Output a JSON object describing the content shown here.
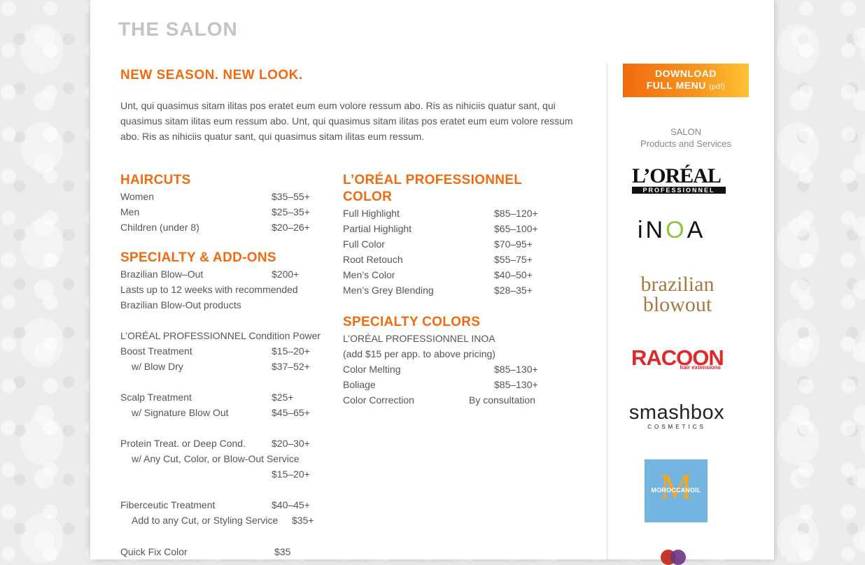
{
  "page_title": "THE SALON",
  "headline": "NEW SEASON. NEW LOOK.",
  "intro": "Unt, qui quasimus sitam ilitas pos eratet eum eum volore ressum abo. Ris as nihiciis quatur sant, qui quasimus sitam ilitas eum ressum abo. Unt, qui quasimus sitam ilitas pos eratet eum eum volore ressum abo. Ris as nihiciis quatur sant, qui quasimus sitam ilitas eum ressum.",
  "haircuts": {
    "title": "HAIRCUTS",
    "rows": [
      {
        "label": "Women",
        "price": "$35–55+"
      },
      {
        "label": "Men",
        "price": "$25–35+"
      },
      {
        "label": "Children (under 8)",
        "price": "$20–26+"
      }
    ]
  },
  "specialty": {
    "title": "SPECIALTY & ADD-ONS",
    "blowout": {
      "label": "Brazilian Blow–Out",
      "price": "$200+"
    },
    "blowout_note_1": "Lasts up to 12 weeks with recommended",
    "blowout_note_2": "Brazilian Blow-Out products",
    "condition_power": "L’ORÉAL PROFESSIONNEL Condition Power",
    "boost": {
      "label": "Boost Treatment",
      "price": "$15–20+"
    },
    "boost_dry": {
      "label": "w/ Blow Dry",
      "price": "$37–52+"
    },
    "scalp": {
      "label": "Scalp Treatment",
      "price": "$25+"
    },
    "scalp_blow": {
      "label": "w/ Signature Blow Out",
      "price": "$45–65+"
    },
    "protein": {
      "label": "Protein Treat. or Deep Cond.",
      "price": "$20–30+"
    },
    "protein_with": "w/ Any Cut, Color, or Blow-Out Service",
    "protein_with_price": "$15–20+",
    "fiberceutic": {
      "label": "Fiberceutic Treatment",
      "price": "$40–45+"
    },
    "fiberceutic_add": {
      "label": "Add to any Cut, or Styling Service",
      "price": "$35+"
    },
    "quick_fix": {
      "label": "Quick Fix Color",
      "price": "$35"
    }
  },
  "color": {
    "title_line1": "L’ORÉAL PROFESSIONNEL",
    "title_line2": "COLOR",
    "rows": [
      {
        "label": "Full Highlight",
        "price": "$85–120+"
      },
      {
        "label": "Partial Highlight",
        "price": "$65–100+"
      },
      {
        "label": "Full Color",
        "price": "$70–95+"
      },
      {
        "label": "Root Retouch",
        "price": "$55–75+"
      },
      {
        "label": "Men’s Color",
        "price": "$40–50+"
      },
      {
        "label": "Men’s Grey Blending",
        "price": "$28–35+"
      }
    ]
  },
  "specialty_colors": {
    "title": "SPECIALTY COLORS",
    "line1": "L’ORÉAL PROFESSIONNEL INOA",
    "line2": "(add $15 per app. to above pricing)",
    "rows": [
      {
        "label": "Color Melting",
        "price": "$85–130+"
      },
      {
        "label": "Boliage",
        "price": "$85–130+"
      },
      {
        "label": "Color Correction",
        "price": "By consultation"
      }
    ]
  },
  "sidebar": {
    "download_line1": "DOWNLOAD",
    "download_line2": "FULL MENU",
    "download_pdf": "(pdf)",
    "heading_line1": "SALON",
    "heading_line2": "Products and Services",
    "loreal_word": "L’ORÉAL",
    "loreal_sub": "PROFESSIONNEL",
    "inoa_i": "iN",
    "inoa_o": "O",
    "inoa_a": "A",
    "brazil_1": "brazilian",
    "brazil_2": "blowout",
    "racoon": "RACOON",
    "racoon_sub": "hair extensions",
    "smashbox": "smashbox",
    "smashbox_sub": "COSMETICS",
    "moroccan_m": "M",
    "moroccan": "MOROCCANOIL"
  },
  "colors": {
    "accent": "#f26a0f",
    "title_gray": "#c4c4c4",
    "body": "#555555"
  }
}
